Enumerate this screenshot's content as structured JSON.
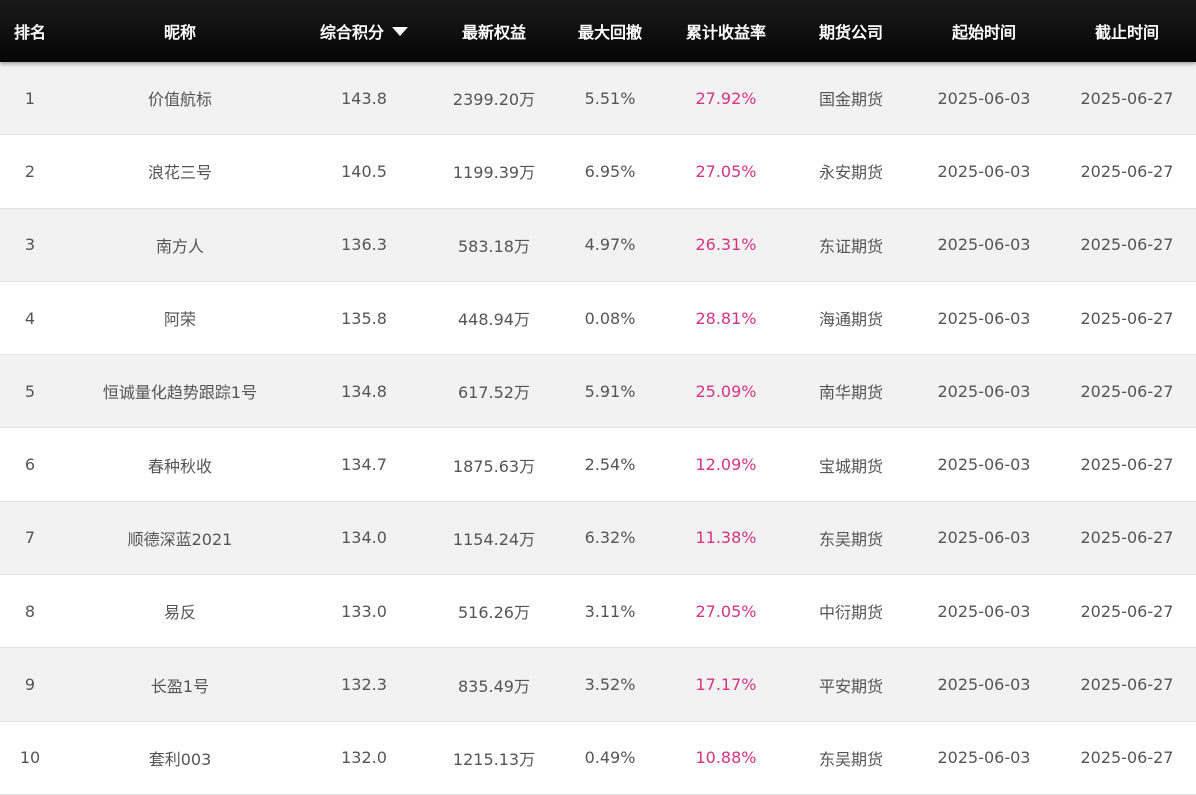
{
  "header": {
    "rank": "排名",
    "nickname": "昵称",
    "score": "综合积分",
    "equity": "最新权益",
    "drawdown": "最大回撤",
    "return": "累计收益率",
    "broker": "期货公司",
    "start": "起始时间",
    "end": "截止时间",
    "sort_icon": "caret-down-icon"
  },
  "colors": {
    "header_bg": "#0a0a0a",
    "return_text": "#d63384",
    "row_alt": "#f2f2f2"
  },
  "rows": [
    {
      "rank": "1",
      "nickname": "价值航标",
      "score": "143.8",
      "equity": "2399.20万",
      "drawdown": "5.51%",
      "return": "27.92%",
      "broker": "国金期货",
      "start": "2025-06-03",
      "end": "2025-06-27"
    },
    {
      "rank": "2",
      "nickname": "浪花三号",
      "score": "140.5",
      "equity": "1199.39万",
      "drawdown": "6.95%",
      "return": "27.05%",
      "broker": "永安期货",
      "start": "2025-06-03",
      "end": "2025-06-27"
    },
    {
      "rank": "3",
      "nickname": "南方人",
      "score": "136.3",
      "equity": "583.18万",
      "drawdown": "4.97%",
      "return": "26.31%",
      "broker": "东证期货",
      "start": "2025-06-03",
      "end": "2025-06-27"
    },
    {
      "rank": "4",
      "nickname": "阿荣",
      "score": "135.8",
      "equity": "448.94万",
      "drawdown": "0.08%",
      "return": "28.81%",
      "broker": "海通期货",
      "start": "2025-06-03",
      "end": "2025-06-27"
    },
    {
      "rank": "5",
      "nickname": "恒诚量化趋势跟踪1号",
      "score": "134.8",
      "equity": "617.52万",
      "drawdown": "5.91%",
      "return": "25.09%",
      "broker": "南华期货",
      "start": "2025-06-03",
      "end": "2025-06-27"
    },
    {
      "rank": "6",
      "nickname": "春种秋收",
      "score": "134.7",
      "equity": "1875.63万",
      "drawdown": "2.54%",
      "return": "12.09%",
      "broker": "宝城期货",
      "start": "2025-06-03",
      "end": "2025-06-27"
    },
    {
      "rank": "7",
      "nickname": "顺德深蓝2021",
      "score": "134.0",
      "equity": "1154.24万",
      "drawdown": "6.32%",
      "return": "11.38%",
      "broker": "东吴期货",
      "start": "2025-06-03",
      "end": "2025-06-27"
    },
    {
      "rank": "8",
      "nickname": "易反",
      "score": "133.0",
      "equity": "516.26万",
      "drawdown": "3.11%",
      "return": "27.05%",
      "broker": "中衍期货",
      "start": "2025-06-03",
      "end": "2025-06-27"
    },
    {
      "rank": "9",
      "nickname": "长盈1号",
      "score": "132.3",
      "equity": "835.49万",
      "drawdown": "3.52%",
      "return": "17.17%",
      "broker": "平安期货",
      "start": "2025-06-03",
      "end": "2025-06-27"
    },
    {
      "rank": "10",
      "nickname": "套利003",
      "score": "132.0",
      "equity": "1215.13万",
      "drawdown": "0.49%",
      "return": "10.88%",
      "broker": "东吴期货",
      "start": "2025-06-03",
      "end": "2025-06-27"
    }
  ]
}
